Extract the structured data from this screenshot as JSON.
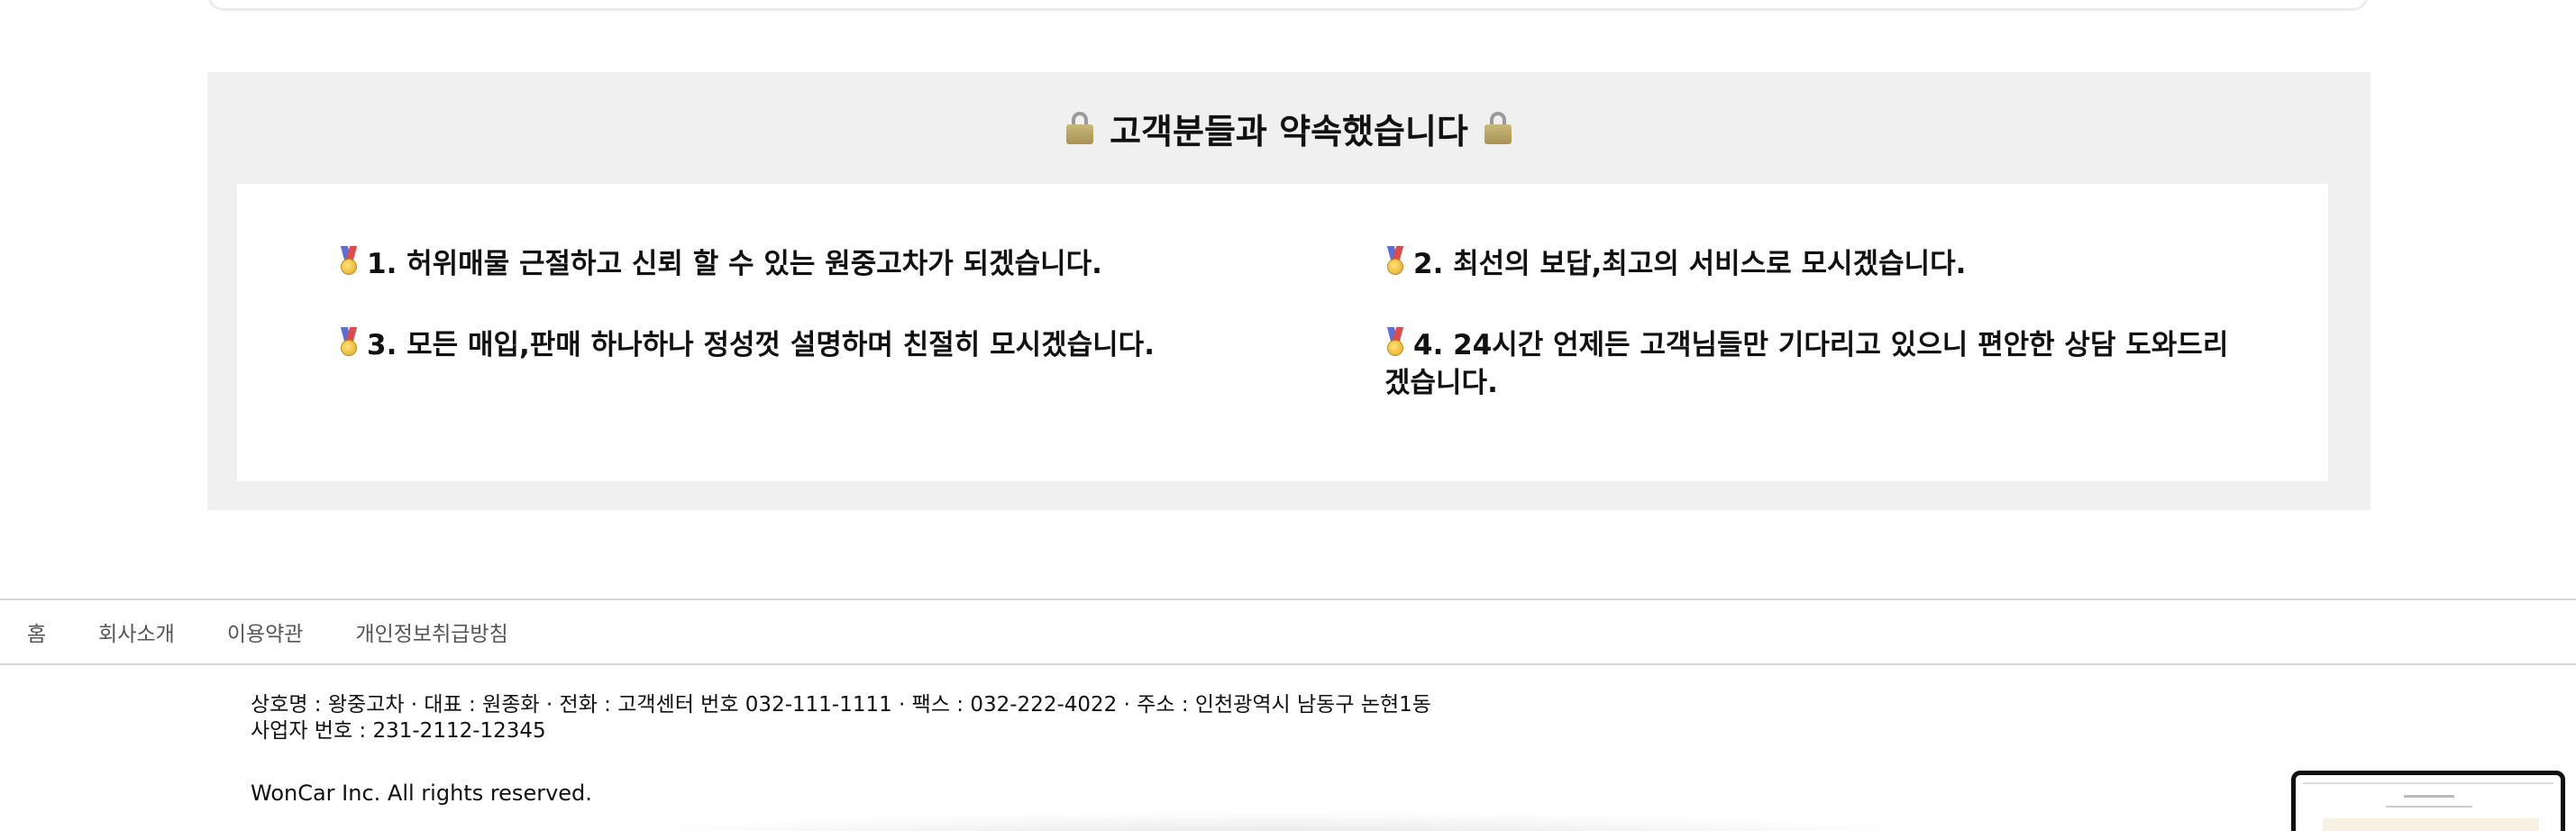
{
  "promise": {
    "title": "고객분들과 약속했습니다",
    "items": [
      "1. 허위매물 근절하고 신뢰 할 수 있는 원중고차가 되겠습니다.",
      "2. 최선의 보답,최고의 서비스로 모시겠습니다.",
      "3. 모든 매입,판매 하나하나 정성껏 설명하며 친절히 모시겠습니다.",
      "4. 24시간 언제든 고객님들만 기다리고 있으니 편안한 상담 도와드리겠습니다."
    ]
  },
  "footer": {
    "nav": [
      "홈",
      "회사소개",
      "이용약관",
      "개인정보취급방침"
    ],
    "company_line1": "상호명 : 왕중고차 · 대표 : 원종화 · 전화 : 고객센터 번호 032-111-1111 · 팩스 : 032-222-4022 · 주소 : 인천광역시 남동구 논현1동",
    "company_line2": "사업자 번호 : 231-2112-12345",
    "copyright": "WonCar Inc. All rights reserved."
  },
  "icons": {
    "title_icon": "lock-icon",
    "item_icon": "medal-icon"
  }
}
